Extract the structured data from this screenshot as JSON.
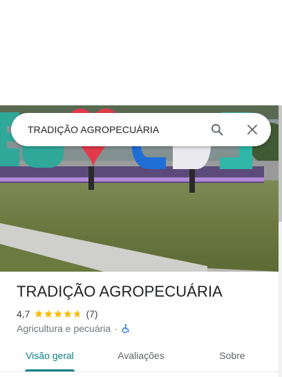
{
  "search": {
    "query": "TRADIÇÃO AGROPECUÁRIA",
    "search_icon": "search-icon",
    "close_icon": "close-icon"
  },
  "place": {
    "name": "TRADIÇÃO AGROPECUÁRIA",
    "rating": "4,7",
    "rating_value": 4.7,
    "rating_max": 5,
    "reviews": "(7)",
    "category": "Agricultura e pecuária",
    "separator": "·",
    "accessibility_icon": "wheelchair-icon"
  },
  "tabs": [
    {
      "label": "Visão geral",
      "active": true
    },
    {
      "label": "Avaliações",
      "active": false
    },
    {
      "label": "Sobre",
      "active": false
    }
  ],
  "colors": {
    "accent": "#0b7f86",
    "star": "#fbbc04",
    "accessibility": "#1a73e8"
  }
}
